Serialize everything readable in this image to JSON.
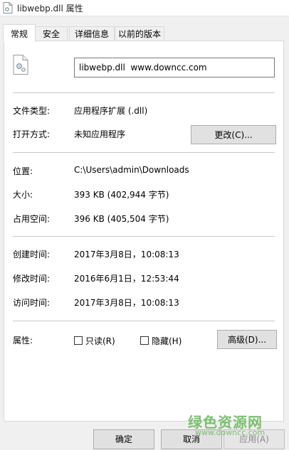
{
  "window": {
    "title": "libwebp.dll 属性"
  },
  "tabs": [
    {
      "label": "常规",
      "active": true
    },
    {
      "label": "安全",
      "active": false
    },
    {
      "label": "详细信息",
      "active": false
    },
    {
      "label": "以前的版本",
      "active": false
    }
  ],
  "general": {
    "file_name": "libwebp.dll  www.downcc.com",
    "type": {
      "label": "文件类型:",
      "value": "应用程序扩展 (.dll)"
    },
    "opens_with": {
      "label": "打开方式:",
      "value": "未知应用程序",
      "change_button": "更改(C)..."
    },
    "location": {
      "label": "位置:",
      "value": "C:\\Users\\admin\\Downloads"
    },
    "size": {
      "label": "大小:",
      "value": "393 KB (402,944 字节)"
    },
    "size_on_disk": {
      "label": "占用空间:",
      "value": "396 KB (405,504 字节)"
    },
    "created": {
      "label": "创建时间:",
      "value": "2017年3月8日，10:08:13"
    },
    "modified": {
      "label": "修改时间:",
      "value": "2016年6月1日，12:53:44"
    },
    "accessed": {
      "label": "访问时间:",
      "value": "2017年3月8日，10:08:13"
    },
    "attributes": {
      "label": "属性:",
      "readonly": "只读(R)",
      "hidden": "隐藏(H)",
      "advanced_button": "高级(D)..."
    }
  },
  "footer": {
    "ok": "确定",
    "cancel": "取消",
    "apply": "应用(A)"
  },
  "watermark": {
    "main": "绿色资源网",
    "sub": "www.downcc.com"
  },
  "colors": {
    "watermark": "#59b04a",
    "panel_border": "#d9d9d9"
  }
}
